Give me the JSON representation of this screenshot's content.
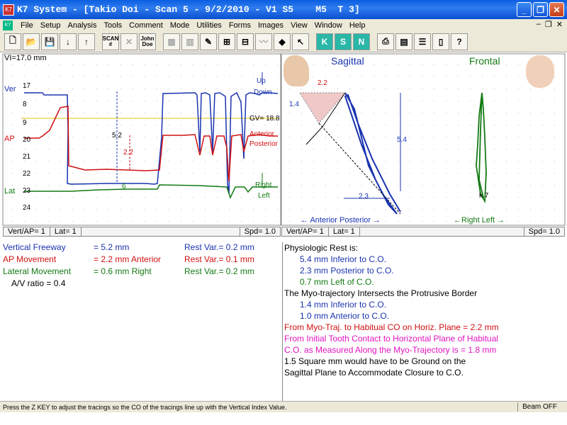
{
  "window": {
    "title": "K7 System - [Takio Doi - Scan 5 - 9/2/2010 - V1 S5    M5  T 3]",
    "app_icon": "K7"
  },
  "menu": [
    "File",
    "Setup",
    "Analysis",
    "Tools",
    "Comment",
    "Mode",
    "Utilities",
    "Forms",
    "Images",
    "View",
    "Window",
    "Help"
  ],
  "toolbar": {
    "scan_label": "SCAN #",
    "john_doe_label": "John Doe"
  },
  "plot_left": {
    "vi_label": "VI=17.0 mm",
    "ver_label": "Ver",
    "ap_label": "AP",
    "lat_label": "Lat",
    "ticks": [
      "17",
      "8",
      "9",
      "20",
      "21",
      "22",
      "23",
      "24"
    ],
    "up": "Up",
    "down": "Down",
    "gv": "GV= 18.8",
    "anterior": "Anterior",
    "posterior": "Posterior",
    "right": "Right",
    "left": "Left",
    "m52": "5.2",
    "m22": "2.2",
    "m6": "6"
  },
  "plot_right": {
    "sagittal": "Sagittal",
    "frontal": "Frontal",
    "m22": "2.2",
    "m14": "1.4",
    "m54": "5.4",
    "m23": "2.3",
    "m7": "k.7",
    "ant_post": "← Anterior   Posterior →",
    "right_left": "←Right    Left →"
  },
  "status_left": {
    "vert_ap": "Vert/AP= 1",
    "lat": "Lat= 1",
    "spd": "Spd= 1.0"
  },
  "status_right": {
    "vert_ap": "Vert/AP= 1",
    "lat": "Lat= 1",
    "spd": "Spd= 1.0"
  },
  "metrics": [
    {
      "label": "Vertical Freeway",
      "value": "= 5.2 mm",
      "var": "Rest Var.= 0.2 mm"
    },
    {
      "label": "AP Movement",
      "value": "= 2.2 mm Anterior",
      "var": "Rest Var.= 0.1 mm"
    },
    {
      "label": "Lateral Movement",
      "value": "= 0.6 mm Right",
      "var": "Rest Var.= 0.2 mm"
    }
  ],
  "av_ratio": "A/V ratio = 0.4",
  "summary": {
    "heading": "Physiologic Rest is:",
    "rest1": "5.4 mm Inferior to C.O.",
    "rest2": "2.3 mm Posterior to C.O.",
    "rest3": "0.7 mm Left of C.O.",
    "myo_heading": "The Myo-trajectory Intersects the Protrusive Border",
    "myo1": "1.4 mm Inferior to C.O.",
    "myo2": "1.0 mm Anterior to C.O.",
    "horiz": "From Myo-Traj. to Habitual CO on Horiz. Plane =  2.2 mm",
    "initial1": "From Initial Tooth Contact to Horizontal Plane of Habitual",
    "initial2": "C.O. as Measured Along the Myo-Trajectory is = 1.8 mm",
    "ground1": "1.5  Square mm would have to be Ground on the",
    "ground2": "Sagittal Plane to  Accommodate Closure to C.O."
  },
  "statusbar": {
    "hint": "Press the  Z KEY  to adjust the tracings so the CO of the tracings line up with the Vertical Index Value.",
    "beam": "Beam OFF"
  },
  "colors": {
    "blue": "#1a33b0",
    "red": "#d01010",
    "green": "#137a13",
    "magenta": "#e014c0",
    "titlebar": "#0b4fd0"
  }
}
